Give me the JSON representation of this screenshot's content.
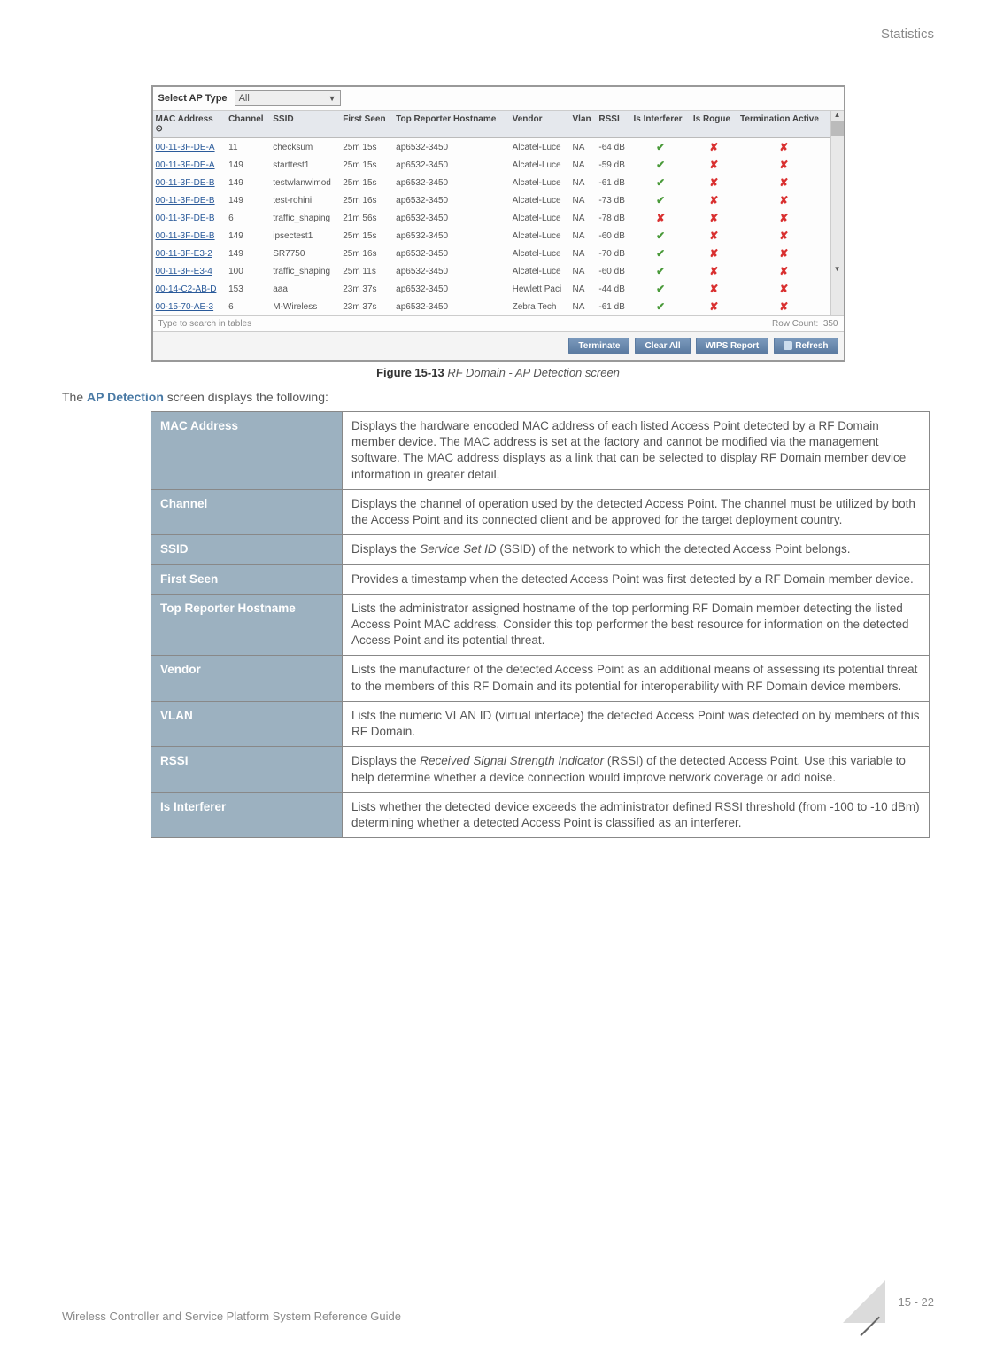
{
  "header": {
    "section": "Statistics"
  },
  "screenshot": {
    "select_label": "Select AP Type",
    "select_value": "All",
    "columns": [
      "MAC Address",
      "Channel",
      "SSID",
      "First Seen",
      "Top Reporter Hostname",
      "Vendor",
      "Vlan",
      "RSSI",
      "Is Interferer",
      "Is Rogue",
      "Termination Active"
    ],
    "rows": [
      {
        "mac": "00-11-3F-DE-A",
        "channel": "11",
        "ssid": "checksum",
        "first": "25m 15s",
        "reporter": "ap6532-3450",
        "vendor": "Alcatel-Luce",
        "vlan": "NA",
        "rssi": "-64 dB",
        "interferer": true,
        "rogue": false,
        "term": false
      },
      {
        "mac": "00-11-3F-DE-A",
        "channel": "149",
        "ssid": "starttest1",
        "first": "25m 15s",
        "reporter": "ap6532-3450",
        "vendor": "Alcatel-Luce",
        "vlan": "NA",
        "rssi": "-59 dB",
        "interferer": true,
        "rogue": false,
        "term": false
      },
      {
        "mac": "00-11-3F-DE-B",
        "channel": "149",
        "ssid": "testwlanwimod",
        "first": "25m 15s",
        "reporter": "ap6532-3450",
        "vendor": "Alcatel-Luce",
        "vlan": "NA",
        "rssi": "-61 dB",
        "interferer": true,
        "rogue": false,
        "term": false
      },
      {
        "mac": "00-11-3F-DE-B",
        "channel": "149",
        "ssid": "test-rohini",
        "first": "25m 16s",
        "reporter": "ap6532-3450",
        "vendor": "Alcatel-Luce",
        "vlan": "NA",
        "rssi": "-73 dB",
        "interferer": true,
        "rogue": false,
        "term": false
      },
      {
        "mac": "00-11-3F-DE-B",
        "channel": "6",
        "ssid": "traffic_shaping",
        "first": "21m 56s",
        "reporter": "ap6532-3450",
        "vendor": "Alcatel-Luce",
        "vlan": "NA",
        "rssi": "-78 dB",
        "interferer": false,
        "rogue": false,
        "term": false
      },
      {
        "mac": "00-11-3F-DE-B",
        "channel": "149",
        "ssid": "ipsectest1",
        "first": "25m 15s",
        "reporter": "ap6532-3450",
        "vendor": "Alcatel-Luce",
        "vlan": "NA",
        "rssi": "-60 dB",
        "interferer": true,
        "rogue": false,
        "term": false
      },
      {
        "mac": "00-11-3F-E3-2",
        "channel": "149",
        "ssid": "SR7750",
        "first": "25m 16s",
        "reporter": "ap6532-3450",
        "vendor": "Alcatel-Luce",
        "vlan": "NA",
        "rssi": "-70 dB",
        "interferer": true,
        "rogue": false,
        "term": false
      },
      {
        "mac": "00-11-3F-E3-4",
        "channel": "100",
        "ssid": "traffic_shaping",
        "first": "25m 11s",
        "reporter": "ap6532-3450",
        "vendor": "Alcatel-Luce",
        "vlan": "NA",
        "rssi": "-60 dB",
        "interferer": true,
        "rogue": false,
        "term": false
      },
      {
        "mac": "00-14-C2-AB-D",
        "channel": "153",
        "ssid": "aaa",
        "first": "23m 37s",
        "reporter": "ap6532-3450",
        "vendor": "Hewlett Paci",
        "vlan": "NA",
        "rssi": "-44 dB",
        "interferer": true,
        "rogue": false,
        "term": false
      },
      {
        "mac": "00-15-70-AE-3",
        "channel": "6",
        "ssid": "M-Wireless",
        "first": "23m 37s",
        "reporter": "ap6532-3450",
        "vendor": "Zebra Tech",
        "vlan": "NA",
        "rssi": "-61 dB",
        "interferer": true,
        "rogue": false,
        "term": false
      }
    ],
    "search_placeholder": "Type to search in tables",
    "row_count_label": "Row Count:",
    "row_count_value": "350",
    "buttons": {
      "terminate": "Terminate",
      "clear_all": "Clear All",
      "wips_report": "WIPS Report",
      "refresh": "Refresh"
    }
  },
  "figure": {
    "label": "Figure 15-13",
    "title": "RF Domain - AP Detection screen"
  },
  "intro": {
    "pre": "The ",
    "bold": "AP Detection",
    "post": " screen displays the following:"
  },
  "definitions": [
    {
      "term": "MAC Address",
      "def": "Displays the hardware encoded MAC address of each listed Access Point detected by a RF Domain member device. The MAC address is set at the factory and cannot be modified via the management software. The MAC address displays as a link that can be selected to display RF Domain member device information in greater detail."
    },
    {
      "term": "Channel",
      "def": "Displays the channel of operation used by the detected Access Point. The channel must be utilized by both the Access Point and its connected client and be approved for the target deployment country."
    },
    {
      "term": "SSID",
      "def": "Displays the <i>Service Set ID</i> (SSID) of the network to which the detected Access Point belongs."
    },
    {
      "term": "First Seen",
      "def": "Provides a timestamp when the detected Access Point was first detected by a RF Domain member device."
    },
    {
      "term": "Top Reporter Hostname",
      "def": "Lists the administrator assigned hostname of the top performing RF Domain member detecting the listed Access Point MAC address. Consider this top performer the best resource for information on the detected Access Point and its potential threat."
    },
    {
      "term": "Vendor",
      "def": "Lists the manufacturer of the detected Access Point as an additional means of assessing its potential threat to the members of this RF Domain and its potential for interoperability with RF Domain device members."
    },
    {
      "term": "VLAN",
      "def": "Lists the numeric VLAN ID (virtual interface) the detected Access Point was detected on by members of this RF Domain."
    },
    {
      "term": "RSSI",
      "def": "Displays the <i>Received Signal Strength Indicator</i> (RSSI) of the detected Access Point. Use this variable to help determine whether a device connection would improve network coverage or add noise."
    },
    {
      "term": "Is Interferer",
      "def": "Lists whether the detected device exceeds the administrator defined RSSI threshold (from -100 to -10 dBm) determining whether a detected Access Point is classified as an interferer."
    }
  ],
  "footer": {
    "left": "Wireless Controller and Service Platform System Reference Guide",
    "page": "15 - 22"
  }
}
